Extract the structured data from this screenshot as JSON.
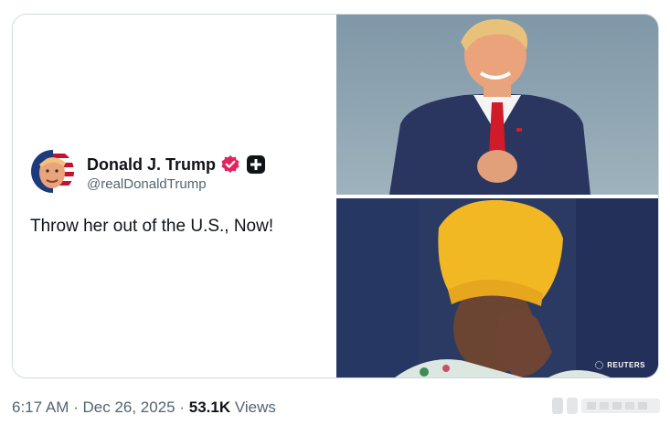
{
  "tweet": {
    "display_name": "Donald J. Trump",
    "handle": "@realDonaldTrump",
    "text": "Throw her out of the U.S., Now!",
    "verified_color": "#e0245e",
    "verified_icon": "verified-icon",
    "affiliation_icon": "plus-badge-icon"
  },
  "media": {
    "top_photo": "photo-man-red-tie-clapping",
    "bottom_photo": "photo-woman-yellow-headscarf",
    "watermark": "REUTERS"
  },
  "meta": {
    "time": "6:17 AM",
    "sep1": " · ",
    "date": "Dec 26, 2025",
    "sep2": " · ",
    "views_count": "53.1K",
    "views_label": " Views"
  },
  "colors": {
    "text_primary": "#0f1419",
    "text_secondary": "#536471",
    "border": "#cfd9de"
  }
}
